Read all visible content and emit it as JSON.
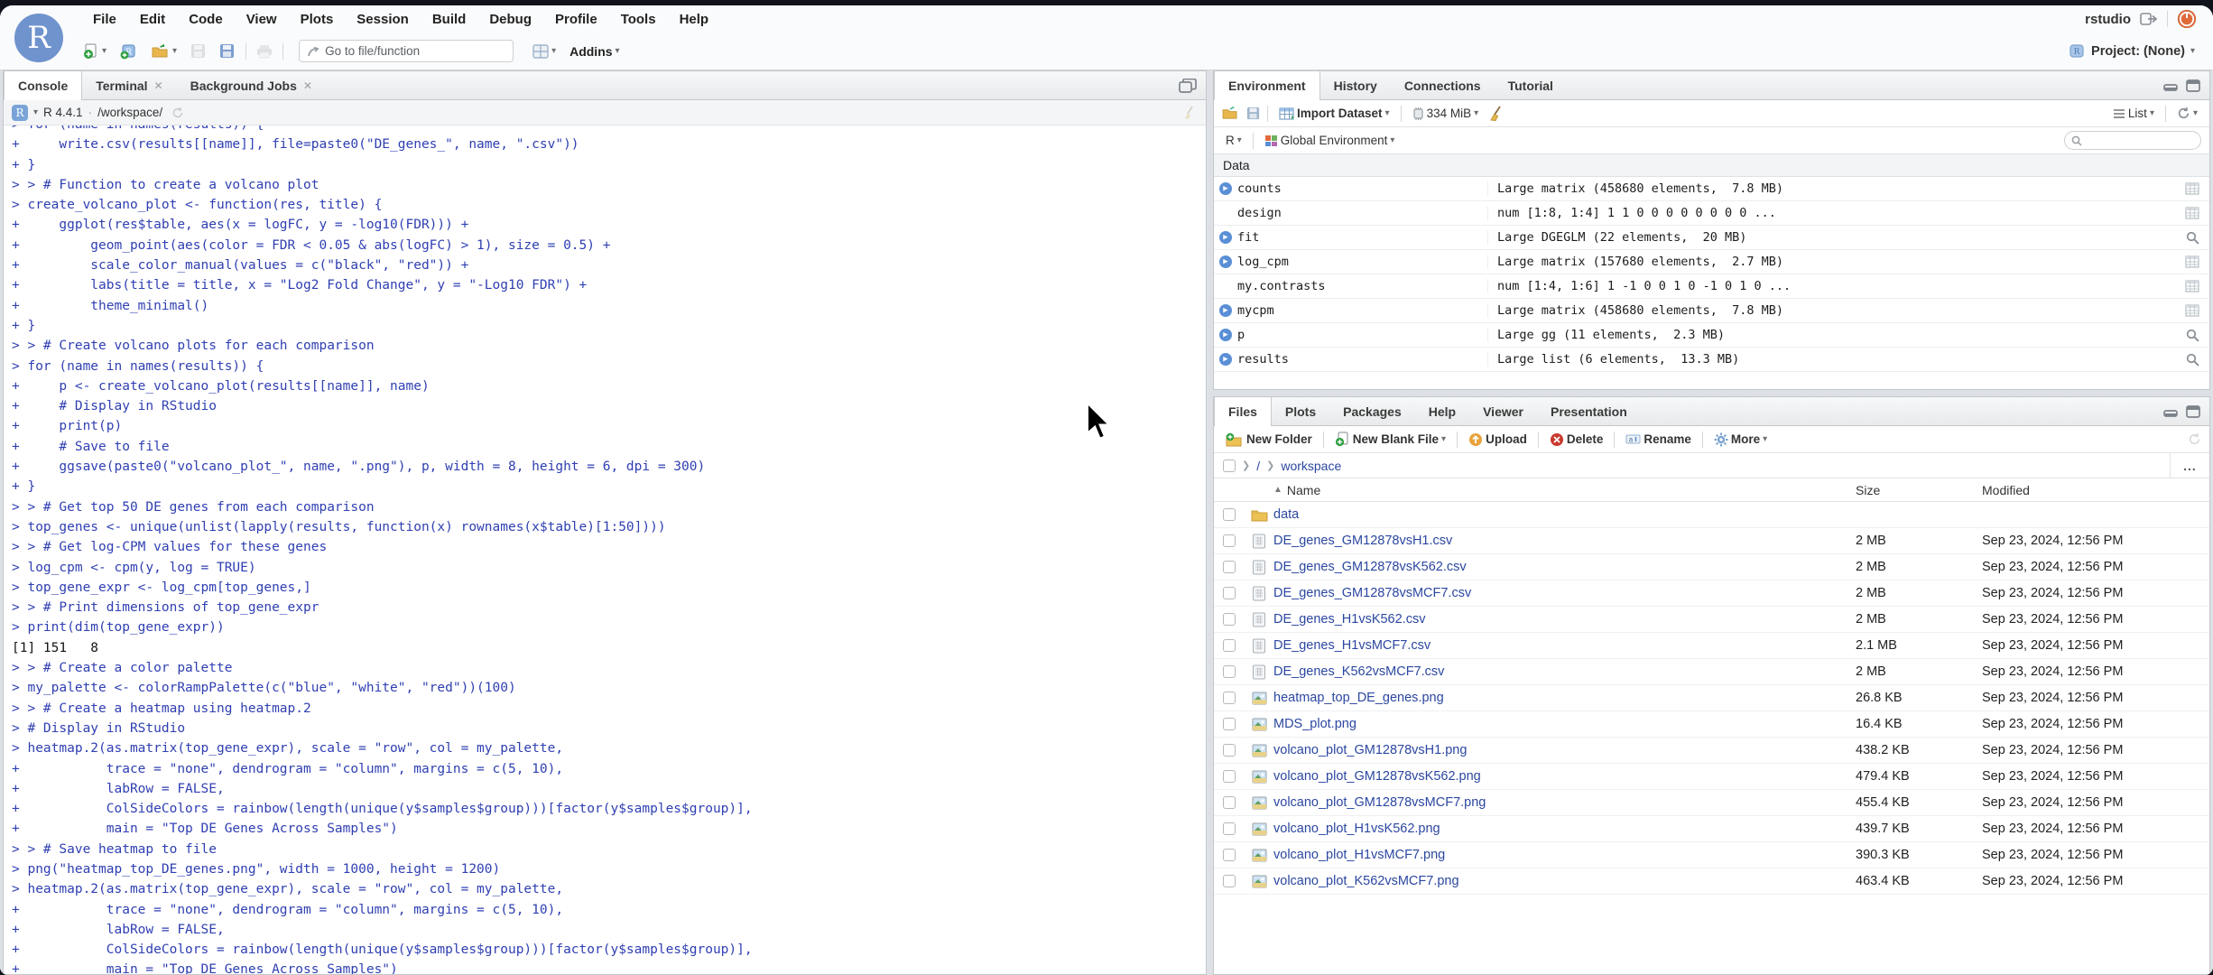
{
  "chrome": {
    "account_label": "rstudio",
    "project_label": "Project: (None)",
    "menu_items": [
      "File",
      "Edit",
      "Code",
      "View",
      "Plots",
      "Session",
      "Build",
      "Debug",
      "Profile",
      "Tools",
      "Help"
    ],
    "goto_placeholder": "Go to file/function",
    "addins_label": "Addins"
  },
  "console_pane": {
    "tabs": [
      {
        "label": "Console",
        "active": true,
        "closable": false
      },
      {
        "label": "Terminal",
        "active": false,
        "closable": true
      },
      {
        "label": "Background Jobs",
        "active": false,
        "closable": true
      }
    ],
    "r_version": "R 4.4.1",
    "separator": "·",
    "working_dir": "/workspace/",
    "lines": [
      {
        "type": "input",
        "text": "> for (name in names(results)) {"
      },
      {
        "type": "input",
        "text": "+     write.csv(results[[name]], file=paste0(\"DE_genes_\", name, \".csv\"))"
      },
      {
        "type": "input",
        "text": "+ }"
      },
      {
        "type": "input",
        "text": "> > # Function to create a volcano plot"
      },
      {
        "type": "input",
        "text": "> create_volcano_plot <- function(res, title) {"
      },
      {
        "type": "input",
        "text": "+     ggplot(res$table, aes(x = logFC, y = -log10(FDR))) +"
      },
      {
        "type": "input",
        "text": "+         geom_point(aes(color = FDR < 0.05 & abs(logFC) > 1), size = 0.5) +"
      },
      {
        "type": "input",
        "text": "+         scale_color_manual(values = c(\"black\", \"red\")) +"
      },
      {
        "type": "input",
        "text": "+         labs(title = title, x = \"Log2 Fold Change\", y = \"-Log10 FDR\") +"
      },
      {
        "type": "input",
        "text": "+         theme_minimal()"
      },
      {
        "type": "input",
        "text": "+ }"
      },
      {
        "type": "input",
        "text": "> > # Create volcano plots for each comparison"
      },
      {
        "type": "input",
        "text": "> for (name in names(results)) {"
      },
      {
        "type": "input",
        "text": "+     p <- create_volcano_plot(results[[name]], name)"
      },
      {
        "type": "input",
        "text": "+     # Display in RStudio"
      },
      {
        "type": "input",
        "text": "+     print(p)"
      },
      {
        "type": "input",
        "text": "+     # Save to file"
      },
      {
        "type": "input",
        "text": "+     ggsave(paste0(\"volcano_plot_\", name, \".png\"), p, width = 8, height = 6, dpi = 300)"
      },
      {
        "type": "input",
        "text": "+ }"
      },
      {
        "type": "input",
        "text": "> > # Get top 50 DE genes from each comparison"
      },
      {
        "type": "input",
        "text": "> top_genes <- unique(unlist(lapply(results, function(x) rownames(x$table)[1:50])))"
      },
      {
        "type": "input",
        "text": "> > # Get log-CPM values for these genes"
      },
      {
        "type": "input",
        "text": "> log_cpm <- cpm(y, log = TRUE)"
      },
      {
        "type": "input",
        "text": "> top_gene_expr <- log_cpm[top_genes,]"
      },
      {
        "type": "input",
        "text": "> > # Print dimensions of top_gene_expr"
      },
      {
        "type": "input",
        "text": "> print(dim(top_gene_expr))"
      },
      {
        "type": "output",
        "text": "[1] 151   8"
      },
      {
        "type": "input",
        "text": "> > # Create a color palette"
      },
      {
        "type": "input",
        "text": "> my_palette <- colorRampPalette(c(\"blue\", \"white\", \"red\"))(100)"
      },
      {
        "type": "input",
        "text": "> > # Create a heatmap using heatmap.2"
      },
      {
        "type": "input",
        "text": "> # Display in RStudio"
      },
      {
        "type": "input",
        "text": "> heatmap.2(as.matrix(top_gene_expr), scale = \"row\", col = my_palette,"
      },
      {
        "type": "input",
        "text": "+           trace = \"none\", dendrogram = \"column\", margins = c(5, 10),"
      },
      {
        "type": "input",
        "text": "+           labRow = FALSE,"
      },
      {
        "type": "input",
        "text": "+           ColSideColors = rainbow(length(unique(y$samples$group)))[factor(y$samples$group)],"
      },
      {
        "type": "input",
        "text": "+           main = \"Top DE Genes Across Samples\")"
      },
      {
        "type": "input",
        "text": "> > # Save heatmap to file"
      },
      {
        "type": "input",
        "text": "> png(\"heatmap_top_DE_genes.png\", width = 1000, height = 1200)"
      },
      {
        "type": "input",
        "text": "> heatmap.2(as.matrix(top_gene_expr), scale = \"row\", col = my_palette,"
      },
      {
        "type": "input",
        "text": "+           trace = \"none\", dendrogram = \"column\", margins = c(5, 10),"
      },
      {
        "type": "input",
        "text": "+           labRow = FALSE,"
      },
      {
        "type": "input",
        "text": "+           ColSideColors = rainbow(length(unique(y$samples$group)))[factor(y$samples$group)],"
      },
      {
        "type": "input",
        "text": "+           main = \"Top DE Genes Across Samples\")"
      }
    ]
  },
  "environment_pane": {
    "tabs": [
      {
        "label": "Environment",
        "active": true
      },
      {
        "label": "History",
        "active": false
      },
      {
        "label": "Connections",
        "active": false
      },
      {
        "label": "Tutorial",
        "active": false
      }
    ],
    "import_label": "Import Dataset",
    "memory_label": "334 MiB",
    "list_label": "List",
    "language_label": "R",
    "scope_label": "Global Environment",
    "section_header": "Data",
    "items": [
      {
        "name": "counts",
        "value": "Large matrix (458680 elements,  7.8 MB)",
        "expandable": true,
        "action": "table"
      },
      {
        "name": "design",
        "value": "num [1:8, 1:4] 1 1 0 0 0 0 0 0 0 0 ...",
        "expandable": false,
        "action": "table"
      },
      {
        "name": "fit",
        "value": "Large DGEGLM (22 elements,  20 MB)",
        "expandable": true,
        "action": "search"
      },
      {
        "name": "log_cpm",
        "value": "Large matrix (157680 elements,  2.7 MB)",
        "expandable": true,
        "action": "table"
      },
      {
        "name": "my.contrasts",
        "value": "num [1:4, 1:6] 1 -1 0 0 1 0 -1 0 1 0 ...",
        "expandable": false,
        "action": "table"
      },
      {
        "name": "mycpm",
        "value": "Large matrix (458680 elements,  7.8 MB)",
        "expandable": true,
        "action": "table"
      },
      {
        "name": "p",
        "value": "Large gg (11 elements,  2.3 MB)",
        "expandable": true,
        "action": "search"
      },
      {
        "name": "results",
        "value": "Large list (6 elements,  13.3 MB)",
        "expandable": true,
        "action": "search"
      }
    ]
  },
  "files_pane": {
    "tabs": [
      {
        "label": "Files",
        "active": true
      },
      {
        "label": "Plots",
        "active": false
      },
      {
        "label": "Packages",
        "active": false
      },
      {
        "label": "Help",
        "active": false
      },
      {
        "label": "Viewer",
        "active": false
      },
      {
        "label": "Presentation",
        "active": false
      }
    ],
    "toolbar": [
      {
        "label": "New Folder",
        "icon": "new-folder",
        "caret": false
      },
      {
        "label": "New Blank File",
        "icon": "new-file",
        "caret": true
      },
      {
        "label": "Upload",
        "icon": "upload",
        "caret": false
      },
      {
        "label": "Delete",
        "icon": "delete",
        "caret": false
      },
      {
        "label": "Rename",
        "icon": "rename",
        "caret": false
      },
      {
        "label": "More",
        "icon": "gear",
        "caret": true
      }
    ],
    "breadcrumb": [
      "/",
      "workspace"
    ],
    "more_button": "...",
    "columns": {
      "name": "Name",
      "size": "Size",
      "modified": "Modified"
    },
    "files": [
      {
        "name": "data",
        "type": "folder",
        "size": "",
        "modified": ""
      },
      {
        "name": "DE_genes_GM12878vsH1.csv",
        "type": "csv",
        "size": "2 MB",
        "modified": "Sep 23, 2024, 12:56 PM"
      },
      {
        "name": "DE_genes_GM12878vsK562.csv",
        "type": "csv",
        "size": "2 MB",
        "modified": "Sep 23, 2024, 12:56 PM"
      },
      {
        "name": "DE_genes_GM12878vsMCF7.csv",
        "type": "csv",
        "size": "2 MB",
        "modified": "Sep 23, 2024, 12:56 PM"
      },
      {
        "name": "DE_genes_H1vsK562.csv",
        "type": "csv",
        "size": "2 MB",
        "modified": "Sep 23, 2024, 12:56 PM"
      },
      {
        "name": "DE_genes_H1vsMCF7.csv",
        "type": "csv",
        "size": "2.1 MB",
        "modified": "Sep 23, 2024, 12:56 PM"
      },
      {
        "name": "DE_genes_K562vsMCF7.csv",
        "type": "csv",
        "size": "2 MB",
        "modified": "Sep 23, 2024, 12:56 PM"
      },
      {
        "name": "heatmap_top_DE_genes.png",
        "type": "image",
        "size": "26.8 KB",
        "modified": "Sep 23, 2024, 12:56 PM"
      },
      {
        "name": "MDS_plot.png",
        "type": "image",
        "size": "16.4 KB",
        "modified": "Sep 23, 2024, 12:56 PM"
      },
      {
        "name": "volcano_plot_GM12878vsH1.png",
        "type": "image",
        "size": "438.2 KB",
        "modified": "Sep 23, 2024, 12:56 PM"
      },
      {
        "name": "volcano_plot_GM12878vsK562.png",
        "type": "image",
        "size": "479.4 KB",
        "modified": "Sep 23, 2024, 12:56 PM"
      },
      {
        "name": "volcano_plot_GM12878vsMCF7.png",
        "type": "image",
        "size": "455.4 KB",
        "modified": "Sep 23, 2024, 12:56 PM"
      },
      {
        "name": "volcano_plot_H1vsK562.png",
        "type": "image",
        "size": "439.7 KB",
        "modified": "Sep 23, 2024, 12:56 PM"
      },
      {
        "name": "volcano_plot_H1vsMCF7.png",
        "type": "image",
        "size": "390.3 KB",
        "modified": "Sep 23, 2024, 12:56 PM"
      },
      {
        "name": "volcano_plot_K562vsMCF7.png",
        "type": "image",
        "size": "463.4 KB",
        "modified": "Sep 23, 2024, 12:56 PM"
      }
    ]
  },
  "colors": {
    "accent_blue": "#5a8fd6",
    "console_input_blue": "#2f3fb2",
    "link_blue": "#2b47a0",
    "power_orange": "#d9512c"
  }
}
